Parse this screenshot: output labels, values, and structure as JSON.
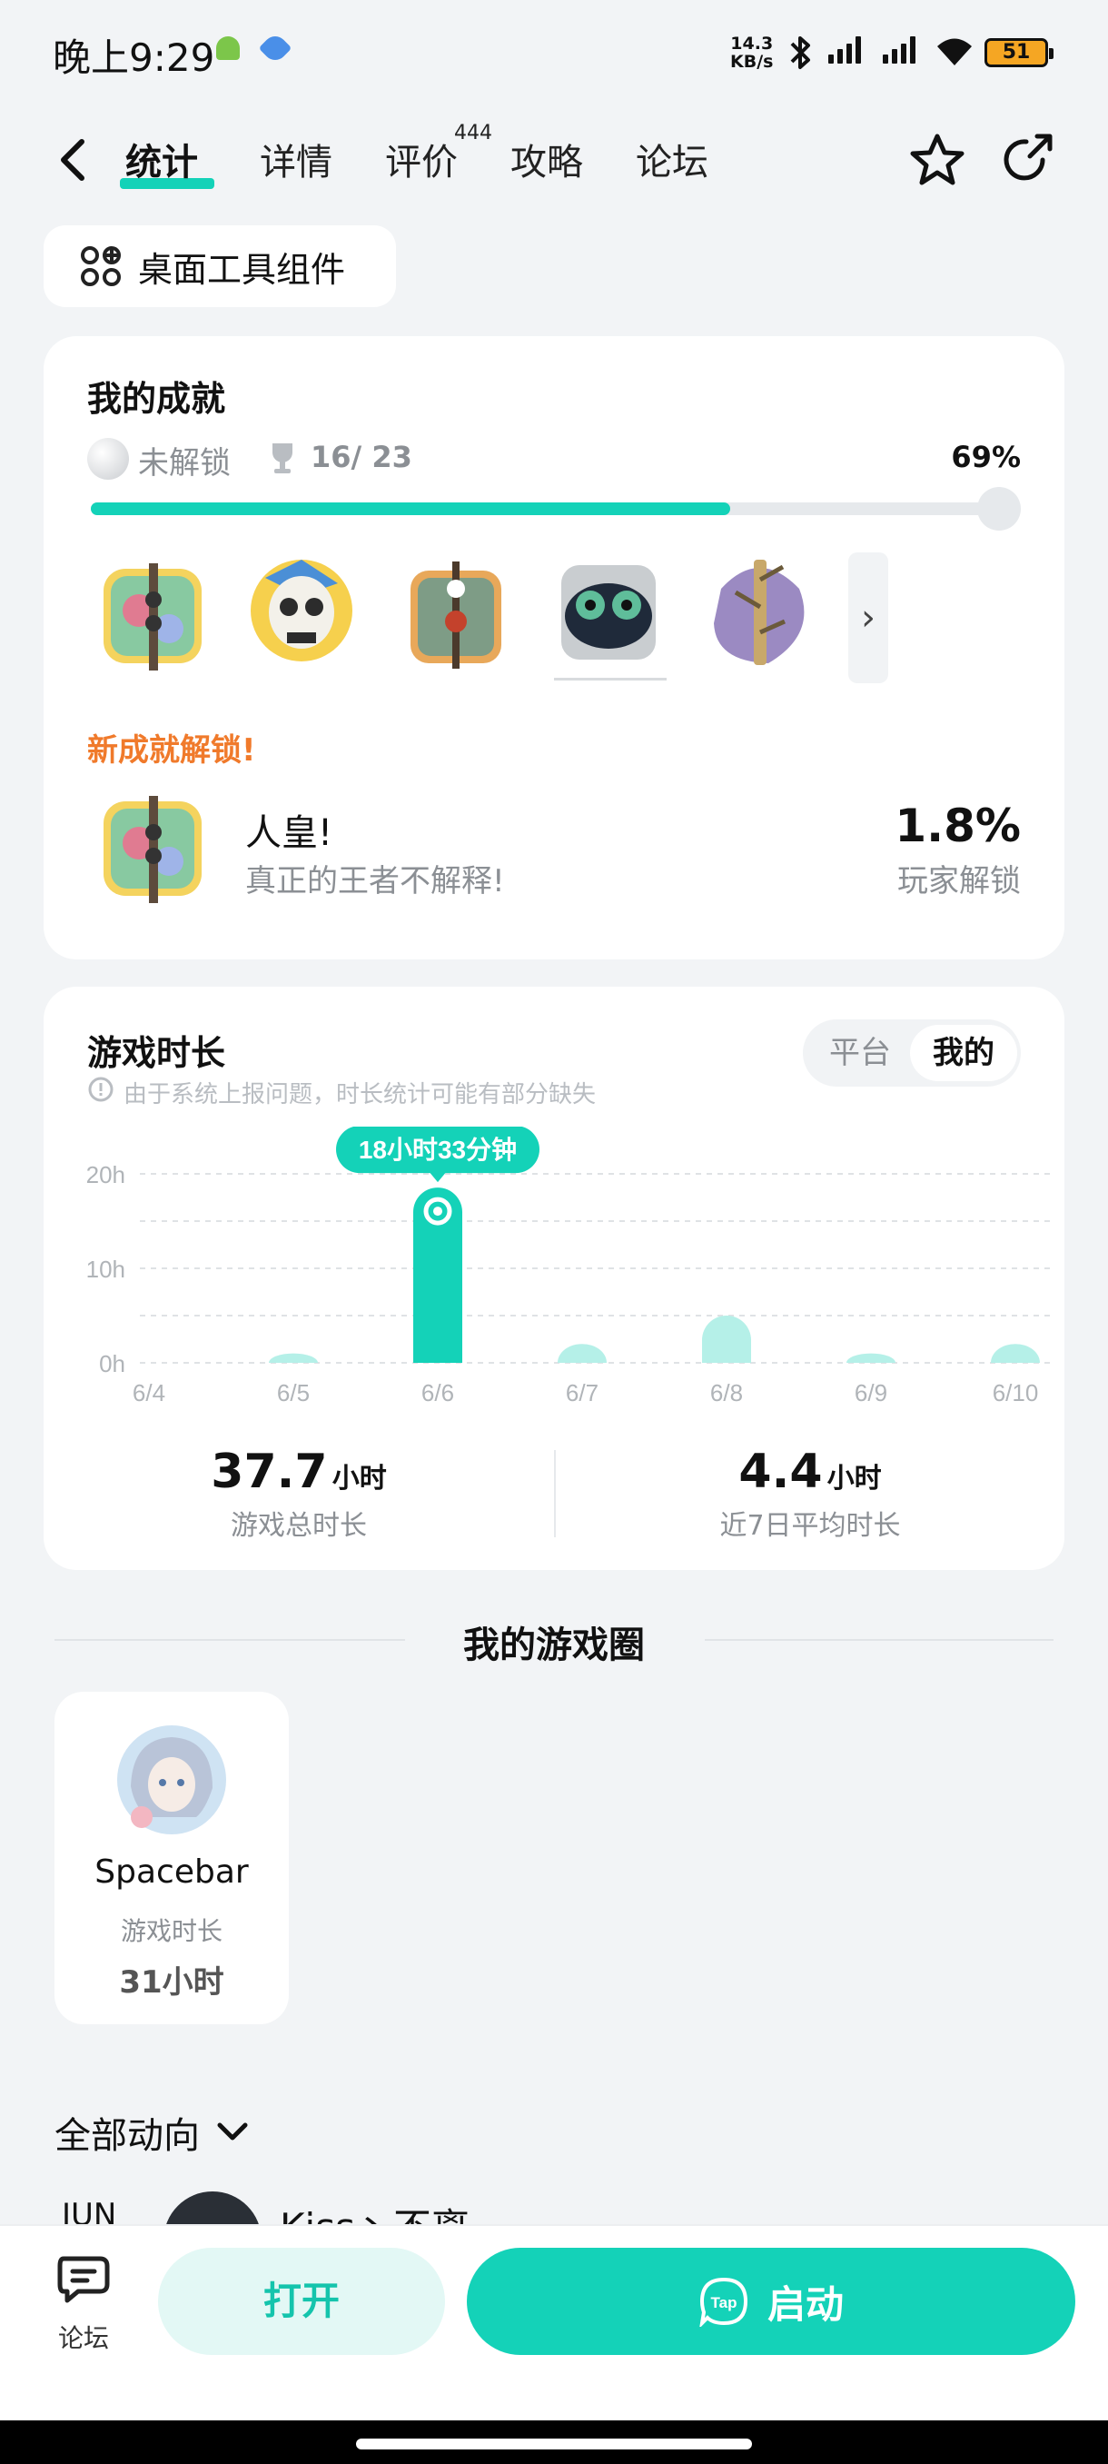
{
  "status_bar": {
    "time": "晚上9:29",
    "net_speed_value": "14.3",
    "net_speed_unit": "KB/s",
    "battery": "51"
  },
  "header": {
    "tabs": [
      {
        "label": "统计",
        "active": true
      },
      {
        "label": "详情"
      },
      {
        "label": "评价",
        "badge": "444"
      },
      {
        "label": "攻略"
      },
      {
        "label": "论坛"
      }
    ]
  },
  "widget_chip": {
    "label": "桌面工具组件"
  },
  "achievements": {
    "title": "我的成就",
    "locked_label": "未解锁",
    "count": "16/ 23",
    "percent": "69%",
    "progress": 0.69,
    "new_unlock_label": "新成就解锁!",
    "latest": {
      "name": "人皇!",
      "desc": "真正的王者不解释!",
      "rate": "1.8%",
      "rate_label": "玩家解锁"
    }
  },
  "playtime": {
    "title": "游戏时长",
    "notice": "由于系统上报问题，时长统计可能有部分缺失",
    "toggle": [
      "平台",
      "我的"
    ],
    "toggle_selected": "我的",
    "tooltip": "18小时33分钟",
    "total_value": "37.7",
    "total_unit": "小时",
    "total_label": "游戏总时长",
    "avg_value": "4.4",
    "avg_unit": "小时",
    "avg_label": "近7日平均时长"
  },
  "chart_data": {
    "type": "bar",
    "categories": [
      "6/4",
      "6/5",
      "6/6",
      "6/7",
      "6/8",
      "6/9",
      "6/10"
    ],
    "values": [
      0,
      1,
      18.55,
      2,
      5,
      1,
      2
    ],
    "ylabel": "",
    "yticks": [
      "0h",
      "10h",
      "20h"
    ],
    "ylim": [
      0,
      20
    ],
    "highlight_index": 2,
    "grid": true
  },
  "game_circle": {
    "title": "我的游戏圈",
    "name": "Spacebar",
    "meta_label": "游戏时长",
    "meta_value": "31小时"
  },
  "feed": {
    "title": "全部动向",
    "month": "JUN",
    "user": "Kiss丶不离"
  },
  "bottom": {
    "forum_label": "论坛",
    "open_label": "打开",
    "launch_label": "启动",
    "tap_logo_text": "Tap"
  },
  "colors": {
    "accent": "#14d2b8",
    "accent_light": "#b5f0e8",
    "orange": "#f07a2b"
  }
}
